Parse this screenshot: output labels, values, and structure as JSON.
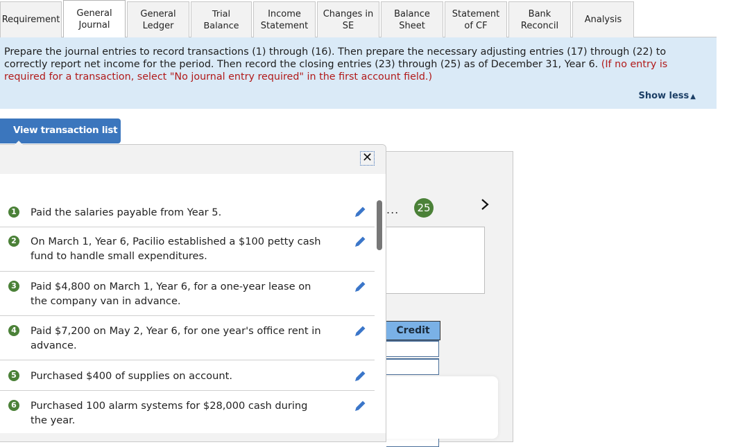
{
  "tabs": [
    {
      "label": "Requirement",
      "active": false
    },
    {
      "label": "General Journal",
      "active": true
    },
    {
      "label": "General Ledger",
      "active": false
    },
    {
      "label": "Trial Balance",
      "active": false
    },
    {
      "label": "Income Statement",
      "active": false
    },
    {
      "label": "Changes in SE",
      "active": false
    },
    {
      "label": "Balance Sheet",
      "active": false
    },
    {
      "label": "Statement of CF",
      "active": false
    },
    {
      "label": "Bank Reconcil",
      "active": false
    },
    {
      "label": "Analysis",
      "active": false
    }
  ],
  "instructions": {
    "main": "Prepare the journal entries to record transactions (1) through (16). Then prepare the necessary adjusting entries (17) through (22) to correctly report net income for the period. Then record the closing entries (23) through (25) as of December 31, Year 6.",
    "note": "(If no entry is required for a transaction, select \"No journal entry required\" in the first account field.)",
    "show_less": "Show less",
    "show_less_icon": "triangle-up-icon"
  },
  "view_transaction_list": "View transaction list",
  "popup": {
    "close_icon": "close-icon",
    "transactions": [
      {
        "num": "1",
        "text": "Paid the salaries payable from Year 5."
      },
      {
        "num": "2",
        "text": "On March 1, Year 6, Pacilio established a $100 petty cash fund to handle small expenditures."
      },
      {
        "num": "3",
        "text": "Paid $4,800 on March 1, Year 6, for a one-year lease on the company van in advance."
      },
      {
        "num": "4",
        "text": "Paid $7,200 on May 2, Year 6, for one year's office rent in advance."
      },
      {
        "num": "5",
        "text": "Purchased $400 of supplies on account."
      },
      {
        "num": "6",
        "text": "Purchased 100 alarm systems for $28,000 cash during the year."
      }
    ]
  },
  "journal": {
    "ellipsis": "...",
    "page_badge": "25",
    "next_icon": "chevron-right-icon",
    "credit_header": "Credit"
  },
  "colors": {
    "accent_blue": "#3b76bd",
    "badge_green": "#4b8138",
    "instructions_bg": "#daeaf7",
    "note_red": "#b11a1a",
    "credit_header_bg": "#7ab1e6"
  }
}
